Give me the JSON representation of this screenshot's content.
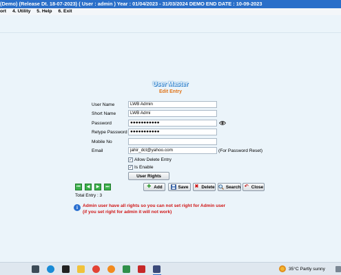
{
  "window": {
    "title": "(Demo) (Release Dt. 18-07-2023)  ( User : admin ) Year : 01/04/2023 - 31/03/2024       DEMO END DATE : 10-09-2023"
  },
  "menu": {
    "items": [
      "ort",
      "4. Utility",
      "5. Help",
      "6. Exit"
    ]
  },
  "form": {
    "title": "User Master",
    "subtitle": "Edit Entry",
    "fields": {
      "user_name": {
        "label": "User Name",
        "value": "LWB Admin"
      },
      "short_name": {
        "label": "Short Name",
        "value": "LWB Admi"
      },
      "password": {
        "label": "Password",
        "value": "●●●●●●●●●●●"
      },
      "retype_password": {
        "label": "Retype Password",
        "value": "●●●●●●●●●●●"
      },
      "mobile_no": {
        "label": "Mobile No",
        "value": ""
      },
      "email": {
        "label": "Email",
        "value": "jahir_dct@yahoo.com",
        "note": "(For Password Reset)"
      }
    },
    "checkboxes": {
      "allow_delete": {
        "label": "Allow Delete Entry",
        "checked": true
      },
      "is_enable": {
        "label": "Is Enable",
        "checked": true
      }
    },
    "user_rights_label": "User Rights"
  },
  "nav": {
    "first": "⏮",
    "prev": "◀",
    "next": "▶",
    "last": "⏭"
  },
  "actions": {
    "add": "Add",
    "save": "Save",
    "delete": "Delete",
    "search": "Search",
    "close": "Close"
  },
  "status": {
    "total_entry": "Total Entry : 3"
  },
  "warning": {
    "line1": "Admin user have all rights so you can not set right for Admin user",
    "line2": "(if you set right for admin it will not work)"
  },
  "taskbar": {
    "weather_temp": "35°C",
    "weather_desc": "Partly sunny"
  },
  "colors": {
    "titlebar": "#2a6fc9",
    "accent_orange": "#e07418",
    "warning_red": "#d01515",
    "nav_green": "#3bb04a"
  },
  "icons": {
    "show_password": "eye-icon",
    "add": "plus-icon",
    "save": "floppy-icon",
    "delete": "x-icon",
    "search": "magnifier-icon",
    "close": "undo-arrow-icon",
    "info": "info-icon"
  }
}
